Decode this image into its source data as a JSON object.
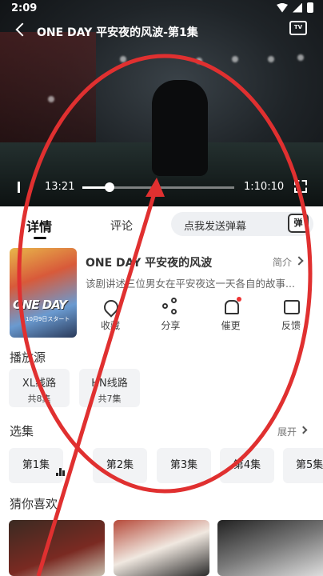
{
  "status_bar": {
    "time": "2:09"
  },
  "player": {
    "title": "ONE DAY 平安夜的风波-第1集",
    "tv_icon": "tv-cast-icon",
    "current_time": "13:21",
    "total_time": "1:10:10",
    "progress": 0.18
  },
  "tabs": {
    "detail": "详情",
    "comment": "评论",
    "danmaku_placeholder": "点我发送弹幕",
    "danmaku_icon_text": "弹"
  },
  "show": {
    "poster_title": "ONE DAY",
    "poster_date": "10月9日スタート",
    "title": "ONE DAY 平安夜的风波",
    "intro_label": "简介",
    "description": "该剧讲述三位男女在平安夜这一天各自的故事..."
  },
  "actions": [
    {
      "label": "收藏",
      "icon": "heart-icon"
    },
    {
      "label": "分享",
      "icon": "share-icon"
    },
    {
      "label": "催更",
      "icon": "bell-icon"
    },
    {
      "label": "反馈",
      "icon": "feedback-icon"
    }
  ],
  "sources": {
    "title": "播放源",
    "items": [
      {
        "name": "XL线路",
        "count": "共8集"
      },
      {
        "name": "HN线路",
        "count": "共7集"
      }
    ]
  },
  "episodes": {
    "title": "选集",
    "expand_label": "展开",
    "items": [
      "第1集",
      "第2集",
      "第3集",
      "第4集",
      "第5集"
    ]
  },
  "recommend": {
    "title": "猜你喜欢"
  },
  "colors": {
    "annotation": "#e03030",
    "chip_bg": "#f2f3f5"
  }
}
